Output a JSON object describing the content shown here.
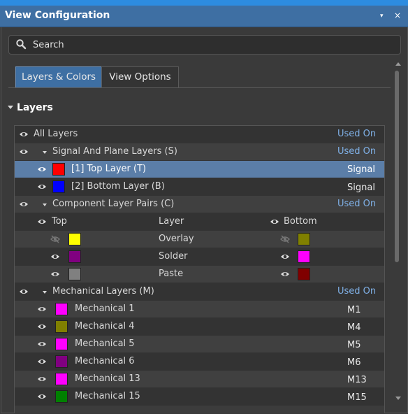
{
  "window": {
    "title": "View Configuration",
    "pin_icon": "▾",
    "close_icon": "×"
  },
  "search": {
    "placeholder": "Search"
  },
  "tabs": [
    {
      "label": "Layers & Colors",
      "active": true
    },
    {
      "label": "View Options",
      "active": false
    }
  ],
  "section": {
    "title": "Layers"
  },
  "rows": [
    {
      "type": "header",
      "label": "All Layers",
      "right": "Used On"
    },
    {
      "type": "group",
      "label": "Signal And Plane Layers (S)",
      "right": "Used On"
    },
    {
      "type": "layer",
      "label": "[1] Top Layer (T)",
      "color": "#ff0000",
      "value": "Signal",
      "selected": true
    },
    {
      "type": "layer",
      "label": "[2] Bottom Layer (B)",
      "color": "#0000ff",
      "value": "Signal"
    },
    {
      "type": "group",
      "label": "Component Layer Pairs (C)",
      "right": "Used On"
    },
    {
      "type": "pairheader",
      "top": "Top",
      "layer": "Layer",
      "bottom": "Bottom"
    },
    {
      "type": "pair",
      "layer": "Overlay",
      "top_color": "#ffff00",
      "bottom_color": "#808000",
      "top_visible": false,
      "bottom_visible": false
    },
    {
      "type": "pair",
      "layer": "Solder",
      "top_color": "#800080",
      "bottom_color": "#ff00ff",
      "top_visible": true,
      "bottom_visible": true
    },
    {
      "type": "pair",
      "layer": "Paste",
      "top_color": "#808080",
      "bottom_color": "#800000",
      "top_visible": true,
      "bottom_visible": true
    },
    {
      "type": "group",
      "label": "Mechanical Layers (M)",
      "right": "Used On"
    },
    {
      "type": "mech",
      "label": "Mechanical 1",
      "color": "#ff00ff",
      "value": "M1"
    },
    {
      "type": "mech",
      "label": "Mechanical 4",
      "color": "#808000",
      "value": "M4"
    },
    {
      "type": "mech",
      "label": "Mechanical 5",
      "color": "#ff00ff",
      "value": "M5"
    },
    {
      "type": "mech",
      "label": "Mechanical 6",
      "color": "#800080",
      "value": "M6"
    },
    {
      "type": "mech",
      "label": "Mechanical 13",
      "color": "#ff00ff",
      "value": "M13"
    },
    {
      "type": "mech",
      "label": "Mechanical 15",
      "color": "#008000",
      "value": "M15"
    }
  ]
}
